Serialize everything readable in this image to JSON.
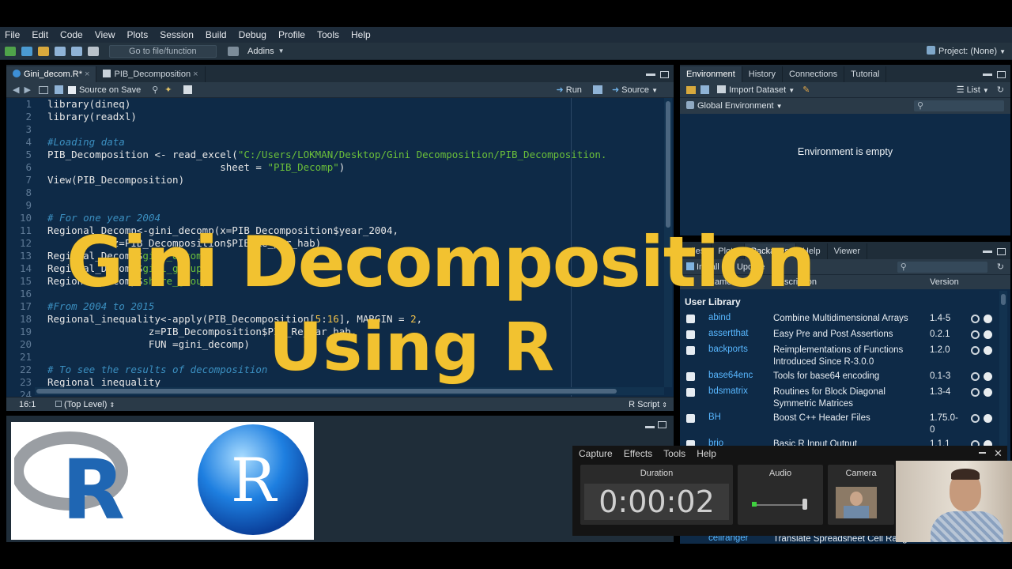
{
  "menu": [
    "File",
    "Edit",
    "Code",
    "View",
    "Plots",
    "Session",
    "Build",
    "Debug",
    "Profile",
    "Tools",
    "Help"
  ],
  "toolbar": {
    "goto_placeholder": "Go to file/function",
    "addins": "Addins",
    "project": "Project: (None)"
  },
  "editor": {
    "tabs": [
      "Gini_decom.R*",
      "PIB_Decomposition"
    ],
    "source_on_save": "Source on Save",
    "run": "Run",
    "source": "Source",
    "lines": [
      {
        "n": "1",
        "html": "library(dineq)"
      },
      {
        "n": "2",
        "html": "library(readxl)"
      },
      {
        "n": "3",
        "html": ""
      },
      {
        "n": "4",
        "html": "<span class='c-comment'>#Loading data</span>"
      },
      {
        "n": "5",
        "html": "PIB_Decomposition <- read_excel(<span class='c-str'>\"C:/Users/LOKMAN/Desktop/Gini Decomposition/PIB_Decomposition.</span>"
      },
      {
        "n": "6",
        "html": "                             sheet = <span class='c-str'>\"PIB_Decomp\"</span>)"
      },
      {
        "n": "7",
        "html": "View(PIB_Decomposition)"
      },
      {
        "n": "8",
        "html": ""
      },
      {
        "n": "9",
        "html": ""
      },
      {
        "n": "10",
        "html": "<span class='c-comment'># For one year 2004</span>"
      },
      {
        "n": "11",
        "html": "Regional_Decomp<-gini_decomp(x=PIB_Decomposition$year_2004,"
      },
      {
        "n": "12",
        "html": "           z=PIB_Decomposition$PIB_Re_par_hab)"
      },
      {
        "n": "13",
        "html": "Regional_Decomp$<span class='c-str'>gini_decomp</span>"
      },
      {
        "n": "14",
        "html": "Regional_Decomp$<span class='c-str'>gini_group</span>"
      },
      {
        "n": "15",
        "html": "Regional_Decomp$<span class='c-str'>share_group</span>"
      },
      {
        "n": "16",
        "html": ""
      },
      {
        "n": "17",
        "html": "<span class='c-comment'>#From 2004 to 2015</span>"
      },
      {
        "n": "18",
        "html": "Regional_inequality<-apply(PIB_Decomposition[<span class='c-num'>5</span>:<span class='c-num'>16</span>], MARGIN = <span class='c-num'>2</span>,"
      },
      {
        "n": "19",
        "html": "                 z=PIB_Decomposition$PIB_Re_par_hab,"
      },
      {
        "n": "20",
        "html": "                 FUN =gini_decomp)"
      },
      {
        "n": "21",
        "html": ""
      },
      {
        "n": "22",
        "html": "<span class='c-comment'># To see the results of decomposition</span>"
      },
      {
        "n": "23",
        "html": "Regional_inequality"
      },
      {
        "n": "24",
        "html": ""
      }
    ],
    "status_pos": "16:1",
    "status_level": "(Top Level)",
    "status_type": "R Script"
  },
  "overlay": {
    "line1": "Gini Decomposition",
    "line2": "Using R"
  },
  "env": {
    "tabs": [
      "Environment",
      "History",
      "Connections",
      "Tutorial"
    ],
    "import": "Import Dataset",
    "list": "List",
    "global": "Global Environment",
    "empty": "Environment is empty"
  },
  "files": {
    "tabs": [
      "Files",
      "Plots",
      "Packages",
      "Help",
      "Viewer"
    ],
    "install": "Install",
    "update": "Update",
    "col_name": "Name",
    "col_desc": "Description",
    "col_ver": "Version",
    "user_library": "User Library",
    "packages": [
      {
        "name": "abind",
        "desc": "Combine Multidimensional Arrays",
        "ver": "1.4-5"
      },
      {
        "name": "assertthat",
        "desc": "Easy Pre and Post Assertions",
        "ver": "0.2.1"
      },
      {
        "name": "backports",
        "desc": "Reimplementations of Functions Introduced Since R-3.0.0",
        "ver": "1.2.0"
      },
      {
        "name": "base64enc",
        "desc": "Tools for base64 encoding",
        "ver": "0.1-3"
      },
      {
        "name": "bdsmatrix",
        "desc": "Routines for Block Diagonal Symmetric Matrices",
        "ver": "1.3-4"
      },
      {
        "name": "BH",
        "desc": "Boost C++ Header Files",
        "ver": "1.75.0-0"
      },
      {
        "name": "brio",
        "desc": "Basic R Input Output",
        "ver": "1.1.1"
      }
    ],
    "last_row": {
      "name": "cellranger",
      "desc": "Translate Spreadsheet Cell Ranges"
    }
  },
  "recorder": {
    "menu": [
      "Capture",
      "Effects",
      "Tools",
      "Help"
    ],
    "duration_label": "Duration",
    "duration": "0:00:02",
    "audio_label": "Audio",
    "camera_label": "Camera"
  },
  "colors": {
    "accent_title": "#f2c230",
    "code_bg": "#0e2a47",
    "pane_bg": "#233240"
  }
}
